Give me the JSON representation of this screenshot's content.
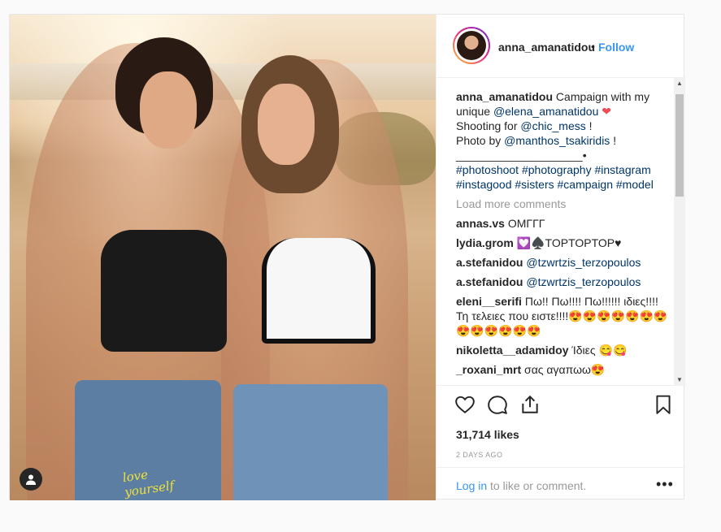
{
  "post": {
    "author": "anna_amanatidou",
    "follow_label": "Follow",
    "separator": "•",
    "caption": {
      "user": "anna_amanatidou",
      "line1": "Campaign with my",
      "line2_prefix": "unique ",
      "line2_mention": "@elena_amanatidou",
      "line2_suffix": "❤",
      "line3_prefix": "Shooting for ",
      "line3_mention": "@chic_mess",
      "line3_suffix": " !",
      "line4_prefix": "Photo by ",
      "line4_mention": "@manthos_tsakiridis",
      "line4_suffix": " !",
      "line5": "____________________•",
      "hashtags_line1": "#photoshoot #photography #instagram",
      "hashtags_line2": "#instagood #sisters #campaign #model"
    },
    "load_more": "Load more comments",
    "comments": [
      {
        "user": "annas.vs",
        "text": "ΟΜΓΓΓ"
      },
      {
        "user": "lydia.grom",
        "text": "💟♠️TOPTOPTOP♥"
      },
      {
        "user": "a.stefanidou",
        "mention": "@tzwrtzis_terzopoulos"
      },
      {
        "user": "a.stefanidou",
        "mention": "@tzwrtzis_terzopoulos"
      },
      {
        "user": "eleni__serifi",
        "text": "Πω!! Πω!!!! Πω!!!!!! ιδιες!!!! Τη τελειες που ειστε!!!!😍😍😍😍😍😍😍😍😍😍😍😍😍"
      },
      {
        "user": "nikoletta__adamidoy",
        "text": "Ίδιες 😋😋"
      },
      {
        "user": "_roxani_mrt",
        "text": "σας αγαπωω😍"
      }
    ],
    "likes": "31,714 likes",
    "time": "2 DAYS AGO",
    "login_link": "Log in",
    "login_suffix": " to like or comment.",
    "more_label": "•••",
    "jeans_text": "love yourself"
  },
  "icons": [
    "heart-icon",
    "comment-icon",
    "share-icon",
    "bookmark-icon",
    "user-icon",
    "more-icon"
  ]
}
